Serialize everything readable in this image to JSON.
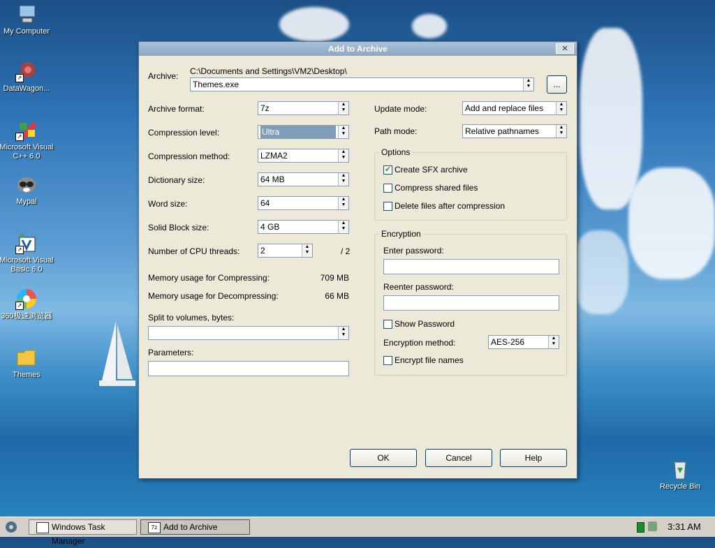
{
  "desktop": {
    "icons": [
      {
        "label": "My Computer"
      },
      {
        "label": "DataWagon..."
      },
      {
        "label": "Microsoft Visual C++ 6.0"
      },
      {
        "label": "Mypal"
      },
      {
        "label": "Microsoft Visual Basic 6.0"
      },
      {
        "label": "360极速浏览器"
      },
      {
        "label": "Themes"
      },
      {
        "label": "Recycle Bin"
      }
    ]
  },
  "dialog": {
    "title": "Add to Archive",
    "close_label": "✕",
    "archive_label": "Archive:",
    "archive_path": "C:\\Documents and Settings\\VM2\\Desktop\\",
    "archive_name": "Themes.exe",
    "browse_label": "...",
    "left": {
      "format_label": "Archive format:",
      "format_value": "7z",
      "level_label": "Compression level:",
      "level_value": "Ultra",
      "method_label": "Compression method:",
      "method_value": "LZMA2",
      "dict_label": "Dictionary size:",
      "dict_value": "64 MB",
      "word_label": "Word size:",
      "word_value": "64",
      "solid_label": "Solid Block size:",
      "solid_value": "4 GB",
      "threads_label": "Number of CPU threads:",
      "threads_value": "2",
      "threads_max": "/ 2",
      "mem_comp_label": "Memory usage for Compressing:",
      "mem_comp_value": "709 MB",
      "mem_decomp_label": "Memory usage for Decompressing:",
      "mem_decomp_value": "66 MB",
      "split_label": "Split to volumes, bytes:",
      "split_value": "",
      "params_label": "Parameters:",
      "params_value": ""
    },
    "right": {
      "update_label": "Update mode:",
      "update_value": "Add and replace files",
      "path_label": "Path mode:",
      "path_value": "Relative pathnames",
      "options_title": "Options",
      "options": [
        {
          "label": "Create SFX archive",
          "checked": true
        },
        {
          "label": "Compress shared files",
          "checked": false
        },
        {
          "label": "Delete files after compression",
          "checked": false
        }
      ],
      "encryption_title": "Encryption",
      "enter_pw_label": "Enter password:",
      "reenter_pw_label": "Reenter password:",
      "show_pw_label": "Show Password",
      "enc_method_label": "Encryption method:",
      "enc_method_value": "AES-256",
      "encrypt_names_label": "Encrypt file names"
    },
    "buttons": {
      "ok": "OK",
      "cancel": "Cancel",
      "help": "Help"
    }
  },
  "taskbar": {
    "tasks": [
      {
        "label": "Windows Task Manager",
        "active": false
      },
      {
        "label": "Add to Archive",
        "active": true
      }
    ],
    "task_icon_7z": "7z",
    "clock": "3:31 AM"
  }
}
